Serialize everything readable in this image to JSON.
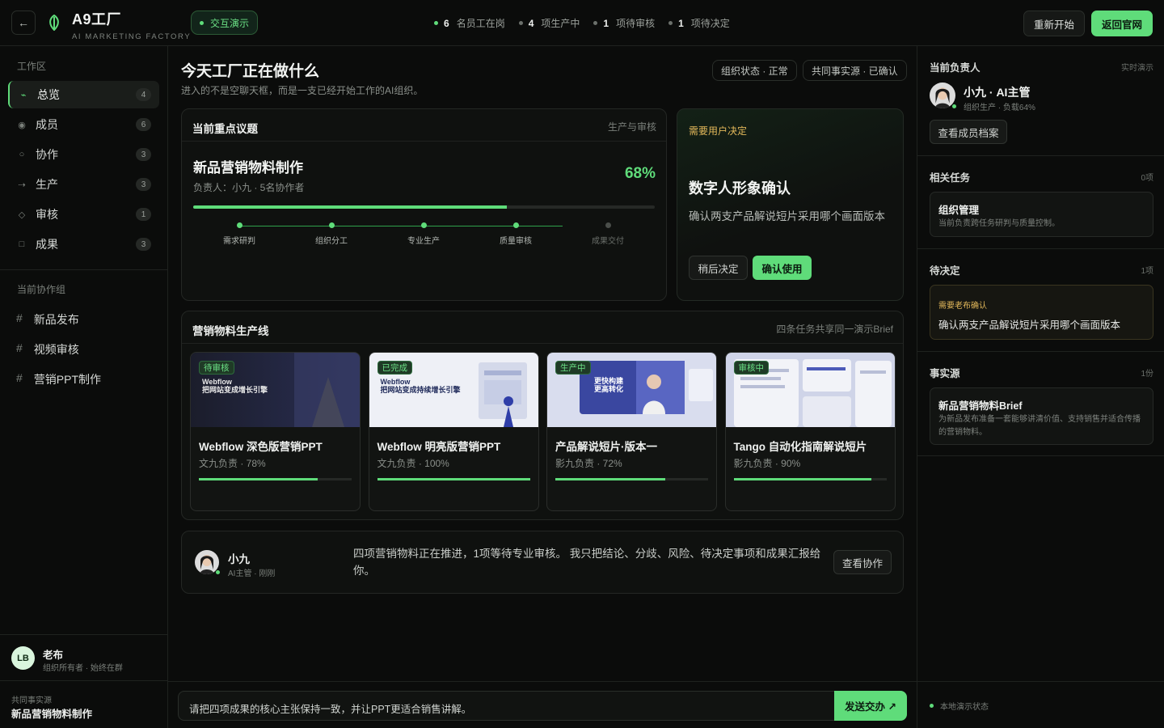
{
  "app": {
    "name": "A9工厂",
    "subtitle": "AI MARKETING FACTORY",
    "demo_label": "交互演示",
    "back_icon": "arrow-left-icon",
    "logo_icon": "leaf-logo-icon"
  },
  "stats": [
    {
      "value": "6",
      "label": "名员工在岗",
      "tone": "green"
    },
    {
      "value": "4",
      "label": "项生产中",
      "tone": "gray"
    },
    {
      "value": "1",
      "label": "项待审核",
      "tone": "gray"
    },
    {
      "value": "1",
      "label": "项待决定",
      "tone": "gray"
    }
  ],
  "actions": {
    "restart": "重新开始",
    "home": "返回官网"
  },
  "sidebar": {
    "workspace_title": "工作区",
    "nav": [
      {
        "label": "总览",
        "count": "4",
        "icon": "pulse-icon",
        "glyph": "⌁",
        "active": true
      },
      {
        "label": "成员",
        "count": "6",
        "icon": "member-dot-icon",
        "glyph": "◉",
        "active": false
      },
      {
        "label": "协作",
        "count": "3",
        "icon": "circle-icon",
        "glyph": "○",
        "active": false
      },
      {
        "label": "生产",
        "count": "3",
        "icon": "flow-icon",
        "glyph": "⇢",
        "active": false
      },
      {
        "label": "审核",
        "count": "1",
        "icon": "diamond-icon",
        "glyph": "◇",
        "active": false
      },
      {
        "label": "成果",
        "count": "3",
        "icon": "square-icon",
        "glyph": "□",
        "active": false
      }
    ],
    "groups_title": "当前协作组",
    "groups": [
      "新品发布",
      "视频审核",
      "营销PPT制作"
    ],
    "owner": {
      "initials": "LB",
      "name": "老布",
      "sub": "组织所有者 · 始终在群"
    },
    "shared_label": "共同事实源",
    "shared_value": "新品营销物料制作"
  },
  "main": {
    "title": "今天工厂正在做什么",
    "subtitle": "进入的不是空聊天框，而是一支已经开始工作的AI组织。",
    "chips": [
      "组织状态 · 正常",
      "共同事实源 · 已确认"
    ],
    "topic": {
      "head": "当前重点议题",
      "head_right": "生产与审核",
      "name": "新品营销物料制作",
      "owner": "负责人：小九 · 5名协作者",
      "progress_label": "68%",
      "progress": 0.68,
      "steps": [
        {
          "label": "需求研判",
          "done": true
        },
        {
          "label": "组织分工",
          "done": true
        },
        {
          "label": "专业生产",
          "done": true
        },
        {
          "label": "质量审核",
          "done": true
        },
        {
          "label": "成果交付",
          "done": false
        }
      ]
    },
    "decision": {
      "tag": "需要用户决定",
      "title": "数字人形象确认",
      "desc": "确认两支产品解说短片采用哪个画面版本",
      "later": "稍后决定",
      "confirm": "确认使用"
    },
    "line": {
      "head": "营销物料生产线",
      "head_right": "四条任务共享同一演示Brief",
      "items": [
        {
          "status": "待审核",
          "thumb_text": "Webflow\n把网站变成增长引擎",
          "name": "Webflow 深色版营销PPT",
          "owner": "文九负责 · 78%",
          "progress": 0.78,
          "theme": "dark"
        },
        {
          "status": "已完成",
          "thumb_text": "Webflow\n把网站变成持续增长引擎",
          "name": "Webflow 明亮版营销PPT",
          "owner": "文九负责 · 100%",
          "progress": 1.0,
          "theme": "light"
        },
        {
          "status": "生产中",
          "thumb_text": "更快构建\n更高转化",
          "name": "产品解说短片·版本一",
          "owner": "影九负责 · 72%",
          "progress": 0.72,
          "theme": "video"
        },
        {
          "status": "审核中",
          "thumb_text": "",
          "name": "Tango 自动化指南解说短片",
          "owner": "影九负责 · 90%",
          "progress": 0.9,
          "theme": "ui"
        }
      ]
    },
    "summary": {
      "name": "小九",
      "role": "AI主管 · 刚刚",
      "text": "四项营销物料正在推进，1项等待专业审核。 我只把结论、分歧、风险、待决定事项和成果汇报给你。",
      "button": "查看协作"
    },
    "composer": {
      "text": "请把四项成果的核心主张保持一致，并让PPT更适合销售讲解。",
      "send": "发送交办 ↗"
    }
  },
  "right": {
    "lead": {
      "title": "当前负责人",
      "meta": "实时演示",
      "name": "小九 · AI主管",
      "sub": "组织生产 · 负载64%",
      "button": "查看成员档案"
    },
    "tasks": {
      "title": "相关任务",
      "meta": "0项",
      "box_title": "组织管理",
      "box_desc": "当前负责跨任务研判与质量控制。"
    },
    "pending": {
      "title": "待决定",
      "meta": "1项",
      "tag": "需要老布确认",
      "text": "确认两支产品解说短片采用哪个画面版本"
    },
    "facts": {
      "title": "事实源",
      "meta": "1份",
      "box_title": "新品营销物料Brief",
      "box_desc": "为新品发布准备一套能够讲清价值、支持销售并适合传播的营销物料。"
    },
    "local_state": "本地演示状态"
  },
  "colors": {
    "accent": "#5fdc7a",
    "warning": "#e3b85a",
    "background": "#0b0c0b"
  }
}
